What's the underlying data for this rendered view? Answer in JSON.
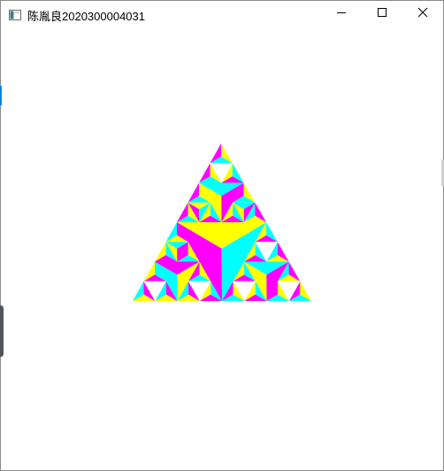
{
  "window": {
    "title": "陈胤良2020300004031",
    "icon": "app-window-icon",
    "controls": {
      "minimize_icon": "minimize-icon",
      "maximize_icon": "maximize-icon",
      "close_icon": "close-icon"
    }
  },
  "palette": {
    "yellow": "#ffff00",
    "magenta": "#ff00ff",
    "cyan": "#00ffff",
    "white": "#ffffff"
  }
}
